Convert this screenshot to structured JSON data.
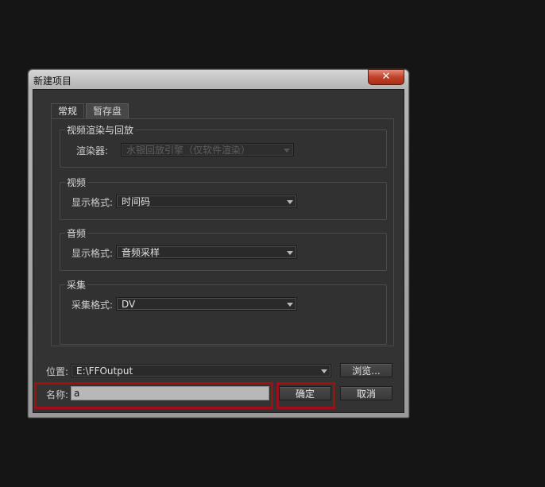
{
  "window": {
    "title": "新建项目",
    "close_glyph": "✕"
  },
  "tabs": [
    {
      "label": "常规",
      "active": true
    },
    {
      "label": "暂存盘",
      "active": false
    }
  ],
  "groups": {
    "render": {
      "title": "视频渲染与回放",
      "label": "渲染器:",
      "value": "水银回放引擎（仅软件渲染）",
      "disabled": true
    },
    "video": {
      "title": "视频",
      "label": "显示格式:",
      "value": "时间码"
    },
    "audio": {
      "title": "音频",
      "label": "显示格式:",
      "value": "音频采样"
    },
    "capture": {
      "title": "采集",
      "label": "采集格式:",
      "value": "DV"
    }
  },
  "location": {
    "label": "位置:",
    "value": "E:\\FFOutput",
    "browse_label": "浏览..."
  },
  "name": {
    "label": "名称:",
    "value": "a"
  },
  "buttons": {
    "ok": "确定",
    "cancel": "取消"
  },
  "colors": {
    "highlight": "#9e0f18",
    "panel_bg": "#333333",
    "page_bg": "#151515"
  }
}
